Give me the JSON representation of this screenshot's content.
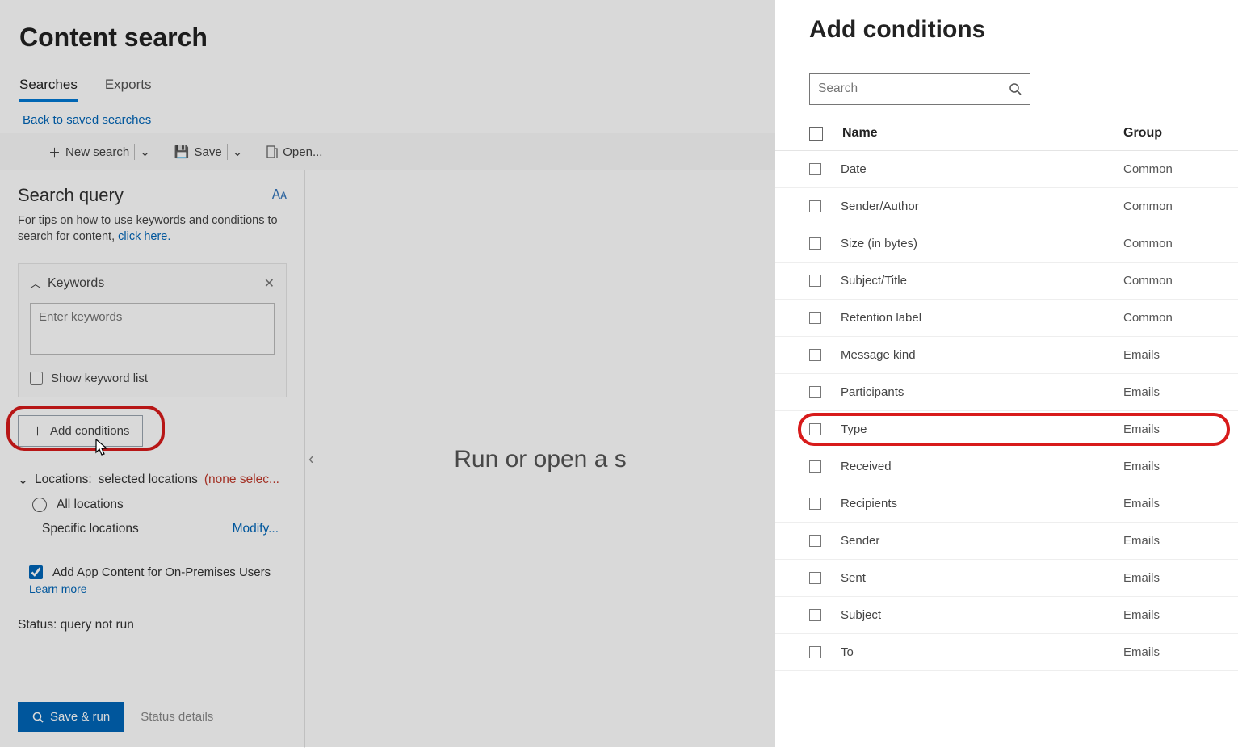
{
  "page": {
    "title": "Content search"
  },
  "tabs": {
    "searches": "Searches",
    "exports": "Exports"
  },
  "links": {
    "back": "Back to saved searches",
    "click_here": "click here."
  },
  "toolbar": {
    "new_search": "New search",
    "save": "Save",
    "open": "Open..."
  },
  "search_query": {
    "title": "Search query",
    "tip_prefix": "For tips on how to use keywords and conditions to search for content, "
  },
  "keywords": {
    "label": "Keywords",
    "placeholder": "Enter keywords",
    "show_list": "Show keyword list"
  },
  "add_conditions_btn": "Add conditions",
  "locations": {
    "prefix": "Locations:",
    "selected": "selected locations",
    "none": "(none selec...",
    "all": "All locations",
    "specific": "Specific locations",
    "modify": "Modify..."
  },
  "app_content": {
    "label": "Add App Content for On-Premises Users",
    "learn": "Learn more"
  },
  "status": {
    "prefix": "Status:",
    "value": "query not run"
  },
  "buttons": {
    "save_run": "Save & run",
    "status_details": "Status details"
  },
  "center": {
    "text": "Run or open a s"
  },
  "panel": {
    "title": "Add conditions",
    "search_placeholder": "Search",
    "col_name": "Name",
    "col_group": "Group",
    "rows": [
      {
        "name": "Date",
        "group": "Common"
      },
      {
        "name": "Sender/Author",
        "group": "Common"
      },
      {
        "name": "Size (in bytes)",
        "group": "Common"
      },
      {
        "name": "Subject/Title",
        "group": "Common"
      },
      {
        "name": "Retention label",
        "group": "Common"
      },
      {
        "name": "Message kind",
        "group": "Emails"
      },
      {
        "name": "Participants",
        "group": "Emails"
      },
      {
        "name": "Type",
        "group": "Emails"
      },
      {
        "name": "Received",
        "group": "Emails"
      },
      {
        "name": "Recipients",
        "group": "Emails"
      },
      {
        "name": "Sender",
        "group": "Emails"
      },
      {
        "name": "Sent",
        "group": "Emails"
      },
      {
        "name": "Subject",
        "group": "Emails"
      },
      {
        "name": "To",
        "group": "Emails"
      }
    ],
    "highlight_index": 7
  }
}
